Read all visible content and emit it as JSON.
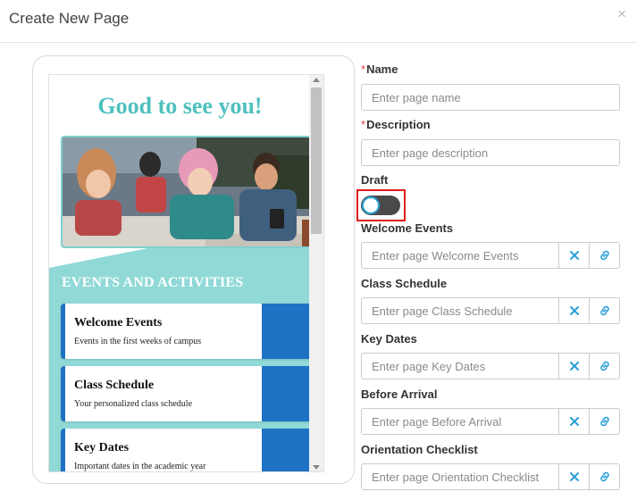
{
  "modal": {
    "title": "Create New Page",
    "close_glyph": "×"
  },
  "preview": {
    "welcome_title": "Good to see you!",
    "events_heading": "EVENTS AND ACTIVITIES",
    "cards": [
      {
        "title": "Welcome Events",
        "subtitle": "Events in the first weeks of campus"
      },
      {
        "title": "Class Schedule",
        "subtitle": "Your personalized class schedule"
      },
      {
        "title": "Key Dates",
        "subtitle": "Important dates in the academic year"
      }
    ]
  },
  "form": {
    "required_mark": "*",
    "name": {
      "label": "Name",
      "placeholder": "Enter page name"
    },
    "description": {
      "label": "Description",
      "placeholder": "Enter page description"
    },
    "draft": {
      "label": "Draft",
      "enabled": false
    },
    "links": [
      {
        "label": "Welcome Events",
        "placeholder": "Enter page Welcome Events"
      },
      {
        "label": "Class Schedule",
        "placeholder": "Enter page Class Schedule"
      },
      {
        "label": "Key Dates",
        "placeholder": "Enter page Key Dates"
      },
      {
        "label": "Before Arrival",
        "placeholder": "Enter page Before Arrival"
      },
      {
        "label": "Orientation Checklist",
        "placeholder": "Enter page Orientation Checklist"
      }
    ]
  },
  "colors": {
    "accent_teal": "#4fc1be",
    "teal_background": "#90d9d7",
    "card_blue": "#1d72c4",
    "icon_blue": "#2a9fd8",
    "required_red": "#e04040",
    "highlight_red": "#e01c1c"
  }
}
